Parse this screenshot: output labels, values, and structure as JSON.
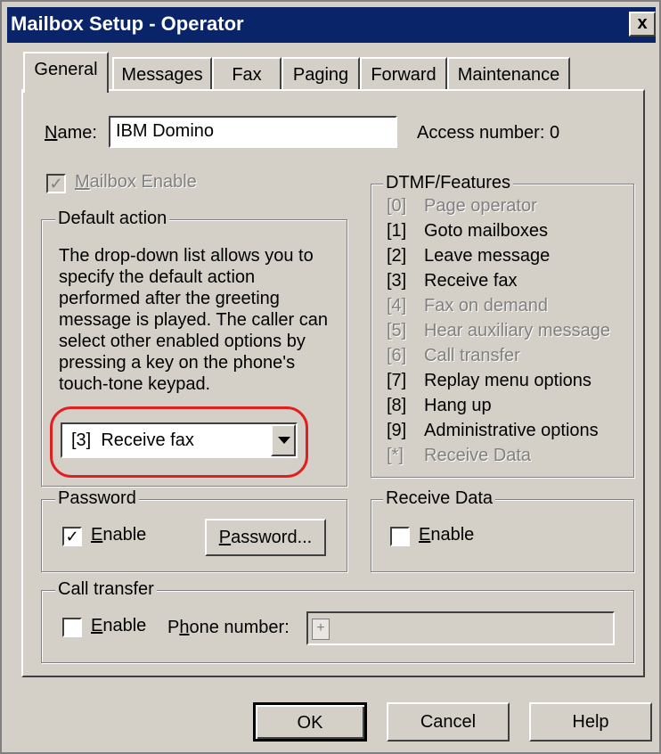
{
  "window": {
    "title": "Mailbox Setup - Operator",
    "close": "x"
  },
  "tabs": [
    "General",
    "Messages",
    "Fax",
    "Paging",
    "Forward",
    "Maintenance"
  ],
  "name_field": {
    "label_u": "N",
    "label_rest": "ame:",
    "value": "IBM Domino"
  },
  "access_number": "Access number: 0",
  "mailbox_enable": {
    "label_u": "M",
    "label_rest": "ailbox Enable",
    "checked": true,
    "disabled": true
  },
  "default_action": {
    "group_label": "Default action",
    "description": [
      "The drop-down list allows you to",
      "specify the default action",
      "performed after the greeting",
      "message is played. The caller can",
      "select other enabled options by",
      "pressing a key on the phone's",
      "touch-tone keypad."
    ],
    "selected": "[3]  Receive fax"
  },
  "dtmf": {
    "group_label": "DTMF/Features",
    "items": [
      {
        "key": "[0]",
        "label": "Page operator",
        "enabled": false
      },
      {
        "key": "[1]",
        "label": "Goto mailboxes",
        "enabled": true
      },
      {
        "key": "[2]",
        "label": "Leave message",
        "enabled": true
      },
      {
        "key": "[3]",
        "label": "Receive fax",
        "enabled": true
      },
      {
        "key": "[4]",
        "label": "Fax on demand",
        "enabled": false
      },
      {
        "key": "[5]",
        "label": "Hear auxiliary message",
        "enabled": false
      },
      {
        "key": "[6]",
        "label": "Call transfer",
        "enabled": false
      },
      {
        "key": "[7]",
        "label": "Replay menu options",
        "enabled": true
      },
      {
        "key": "[8]",
        "label": "Hang up",
        "enabled": true
      },
      {
        "key": "[9]",
        "label": "Administrative options",
        "enabled": true
      },
      {
        "key": "[*]",
        "label": "Receive Data",
        "enabled": false
      }
    ]
  },
  "password": {
    "group_label": "Password",
    "enable_label_u": "E",
    "enable_label_rest": "nable",
    "checked": true,
    "button_u": "P",
    "button_rest": "assword..."
  },
  "receive_data": {
    "group_label": "Receive Data",
    "enable_label_u": "E",
    "enable_label_rest": "nable",
    "checked": false
  },
  "call_transfer": {
    "group_label": "Call transfer",
    "enable_label_u": "E",
    "enable_label_rest": "nable",
    "checked": false,
    "phone_label_pre": "P",
    "phone_label_u": "h",
    "phone_label_rest": "one number:",
    "phone_value": "+"
  },
  "buttons": {
    "ok": "OK",
    "cancel": "Cancel",
    "help": "Help"
  }
}
